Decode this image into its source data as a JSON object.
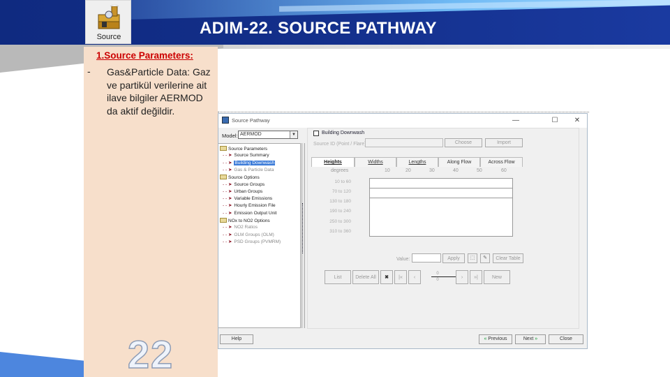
{
  "slide": {
    "title": "ADIM-22. SOURCE PATHWAY",
    "source_icon_label": "Source",
    "note_heading": "1.Source Parameters:",
    "note_bullet": "-",
    "note_text": "Gas&Particle Data: Gaz ve partikül verilerine ait ilave bilgiler AERMOD da aktif değildir.",
    "slide_number": "22"
  },
  "window": {
    "title": "Source Pathway",
    "minimize": "—",
    "maximize": "☐",
    "close": "✕",
    "model_label": "Model:",
    "model_value": "AERMOD",
    "tree": [
      {
        "type": "folder",
        "label": "Source Parameters"
      },
      {
        "type": "item",
        "label": "Source Summary"
      },
      {
        "type": "item",
        "label": "Building Downwash",
        "selected": true
      },
      {
        "type": "item",
        "label": "Gas & Particle Data",
        "dim": true
      },
      {
        "type": "folder",
        "label": "Source Options"
      },
      {
        "type": "item",
        "label": "Source Groups"
      },
      {
        "type": "item",
        "label": "Urban Groups"
      },
      {
        "type": "item",
        "label": "Variable Emissions"
      },
      {
        "type": "item",
        "label": "Hourly Emission File"
      },
      {
        "type": "item",
        "label": "Emission Output Unit"
      },
      {
        "type": "folder",
        "label": "NOx to NO2 Options"
      },
      {
        "type": "item",
        "label": "NO2 Ratios",
        "dim": true
      },
      {
        "type": "item",
        "label": "OLM Groups (OLM)",
        "dim": true
      },
      {
        "type": "item",
        "label": "PSD Groups (PVMRM)",
        "dim": true
      }
    ],
    "building_downwash_label": "Building Downwash",
    "source_id_label": "Source ID (Point / Flare):",
    "choose_button": "Choose",
    "import_button": "Import",
    "tabs": [
      "Heights",
      "Widths",
      "Lengths",
      "Along Flow",
      "Across Flow"
    ],
    "active_tab": "Heights",
    "degrees_label": "degrees",
    "degree_columns": [
      "10",
      "20",
      "30",
      "40",
      "50",
      "60"
    ],
    "row_labels": [
      "10 to 60",
      "70 to 120",
      "130 to 180",
      "190 to 240",
      "250 to 300",
      "310 to 360"
    ],
    "value_label": "Value:",
    "apply_button": "Apply",
    "clear_table_button": "Clear Table",
    "list_button": "List",
    "delete_all_button": "Delete All",
    "nav_current": "0",
    "nav_total": "0",
    "new_button": "New",
    "help_button": "Help",
    "previous_button": "Previous",
    "next_button": "Next",
    "close_button": "Close"
  }
}
